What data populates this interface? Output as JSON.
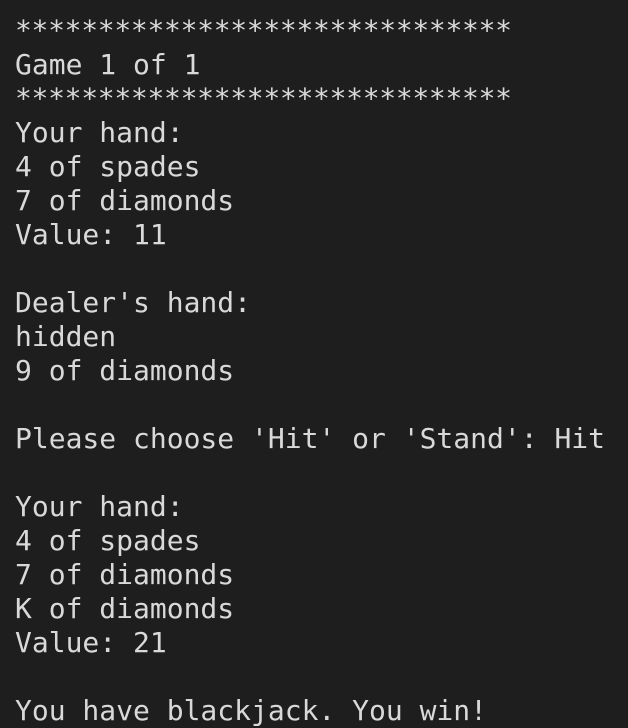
{
  "terminal": {
    "lines": [
      "******************************",
      "Game 1 of 1",
      "******************************",
      "Your hand:",
      "4 of spades",
      "7 of diamonds",
      "Value: 11",
      "",
      "Dealer's hand:",
      "hidden",
      "9 of diamonds",
      "",
      "Please choose 'Hit' or 'Stand': Hit",
      "",
      "Your hand:",
      "4 of spades",
      "7 of diamonds",
      "K of diamonds",
      "Value: 21",
      "",
      "You have blackjack. You win!"
    ]
  },
  "colors": {
    "background": "#1e1e1e",
    "text": "#d9d9d9"
  }
}
